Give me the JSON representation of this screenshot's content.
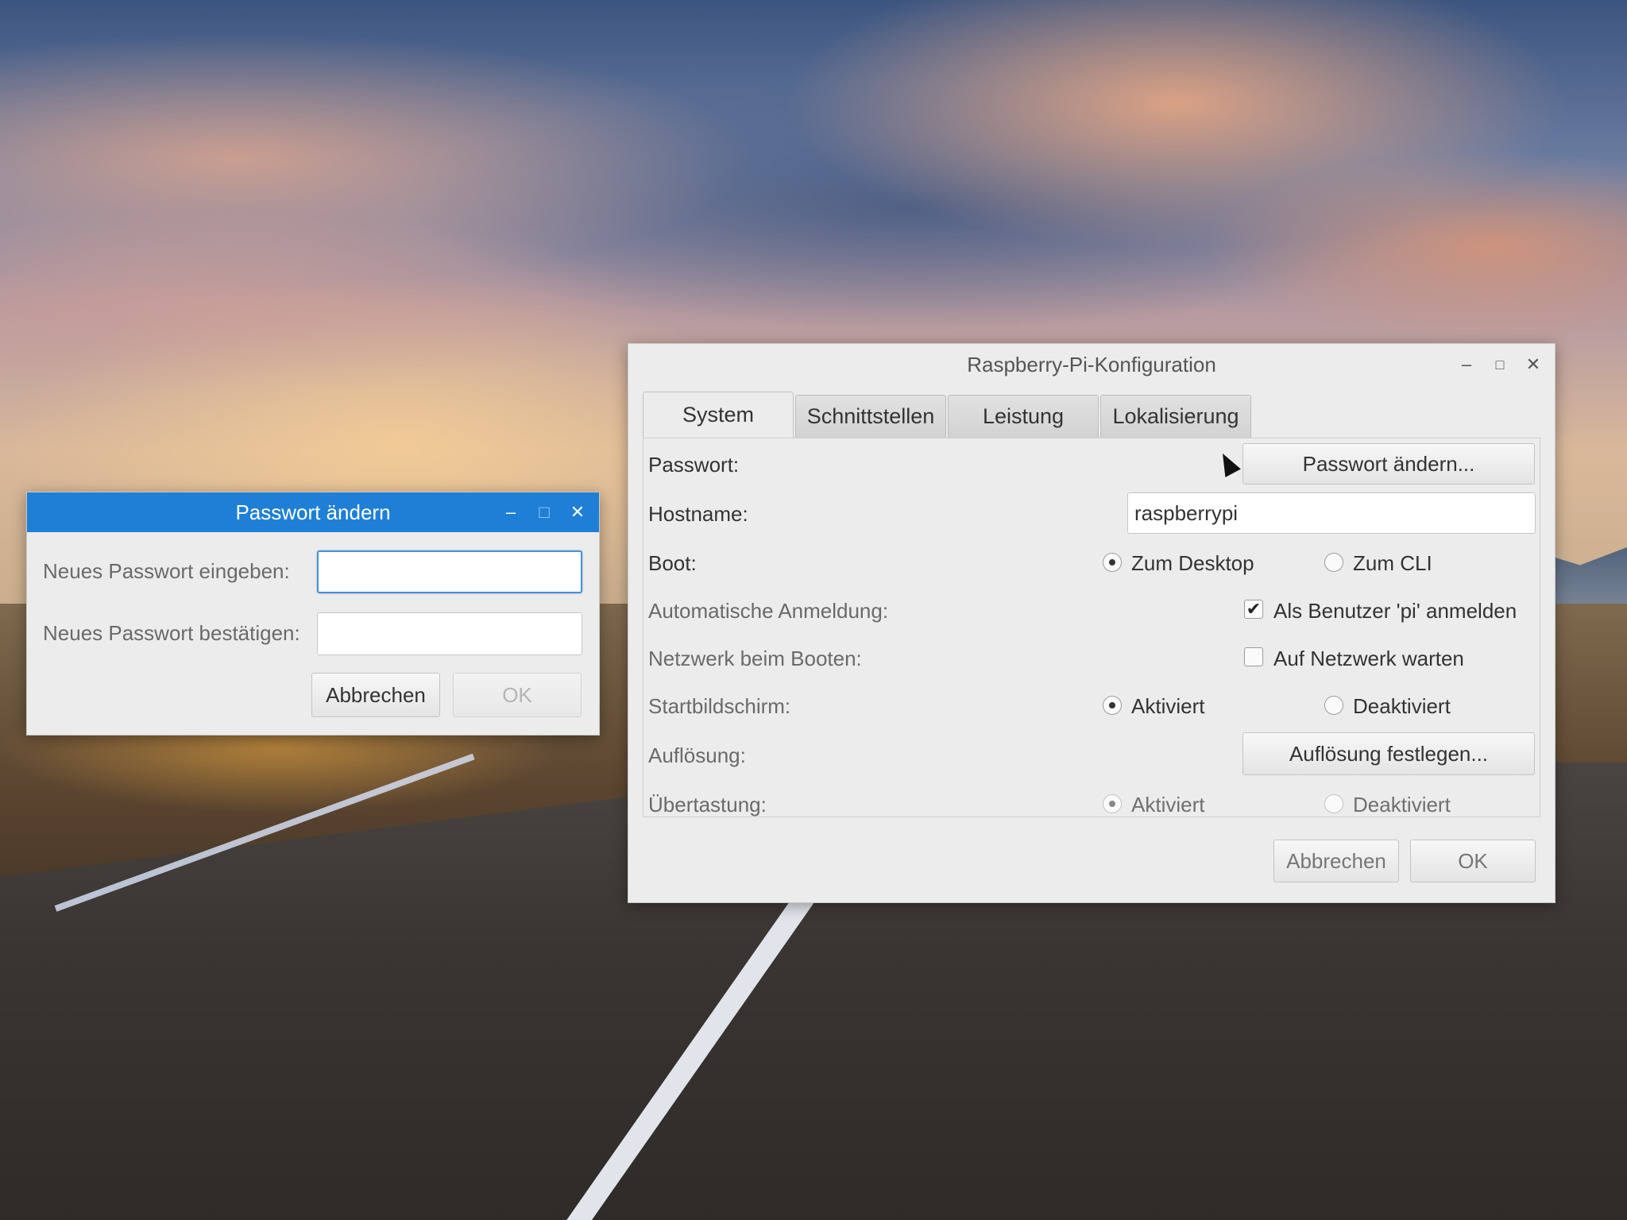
{
  "password_dialog": {
    "title": "Passwort ändern",
    "minimize_glyph": "–",
    "maximize_glyph": "□",
    "close_glyph": "✕",
    "new_password_label": "Neues Passwort eingeben:",
    "new_password_value": "",
    "confirm_password_label": "Neues Passwort bestätigen:",
    "confirm_password_value": "",
    "cancel_label": "Abbrechen",
    "ok_label": "OK"
  },
  "config_window": {
    "title": "Raspberry-Pi-Konfiguration",
    "minimize_glyph": "–",
    "maximize_glyph": "□",
    "close_glyph": "✕",
    "tabs": [
      {
        "label": "System",
        "active": true
      },
      {
        "label": "Schnittstellen",
        "active": false
      },
      {
        "label": "Leistung",
        "active": false
      },
      {
        "label": "Lokalisierung",
        "active": false
      }
    ],
    "rows": {
      "password": {
        "label": "Passwort:",
        "button": "Passwort ändern..."
      },
      "hostname": {
        "label": "Hostname:",
        "value": "raspberrypi"
      },
      "boot": {
        "label": "Boot:",
        "option_a": "Zum Desktop",
        "option_b": "Zum CLI",
        "selected": "Zum Desktop"
      },
      "autologin": {
        "label": "Automatische Anmeldung:",
        "checkbox": "Als Benutzer 'pi' anmelden",
        "checked": true
      },
      "network_boot": {
        "label": "Netzwerk beim Booten:",
        "checkbox": "Auf Netzwerk warten",
        "checked": false
      },
      "splash": {
        "label": "Startbildschirm:",
        "option_a": "Aktiviert",
        "option_b": "Deaktiviert",
        "selected": "Aktiviert"
      },
      "resolution": {
        "label": "Auflösung:",
        "button": "Auflösung festlegen..."
      },
      "overscan": {
        "label": "Übertastung:",
        "option_a": "Aktiviert",
        "option_b": "Deaktiviert",
        "selected": "Aktiviert"
      }
    },
    "check_glyph": "✔",
    "cancel_label": "Abbrechen",
    "ok_label": "OK"
  },
  "colors": {
    "dialog_title_blue": "#1f7fd6",
    "window_bg": "#ececec",
    "focus_border": "#4a90d9"
  }
}
